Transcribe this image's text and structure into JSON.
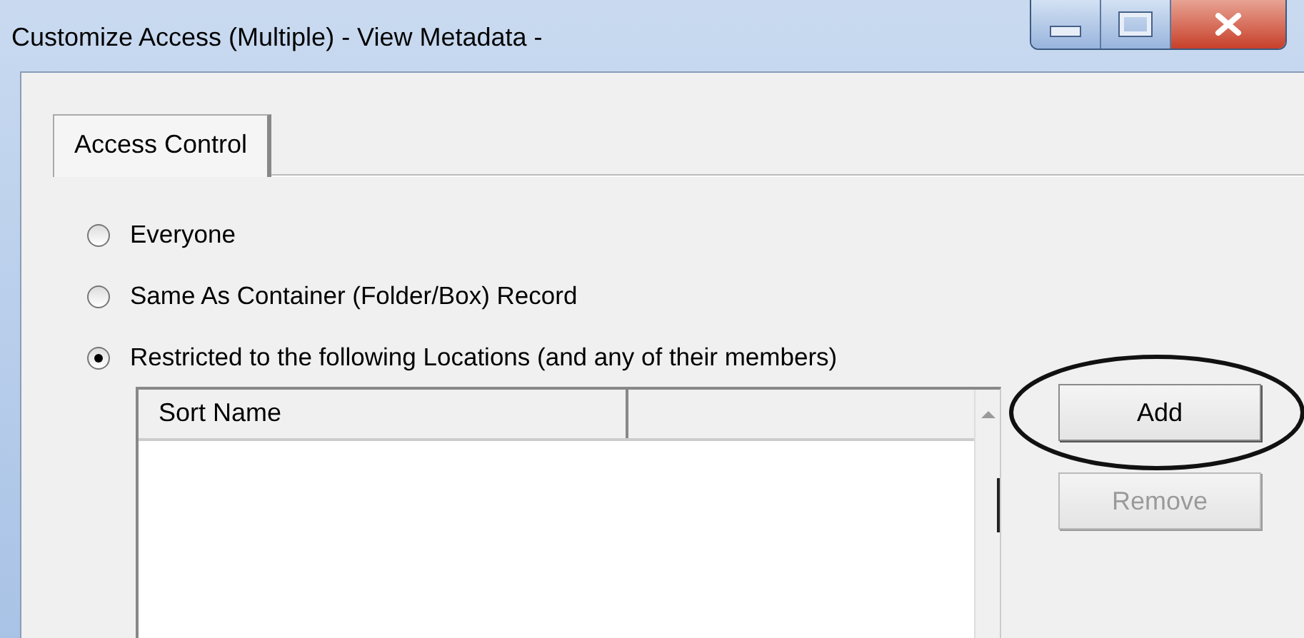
{
  "window": {
    "title": "Customize Access (Multiple) - View Metadata -"
  },
  "tabs": [
    {
      "label": "Access Control",
      "selected": true
    }
  ],
  "access_options": [
    {
      "label": "Everyone",
      "selected": false
    },
    {
      "label": "Same As Container (Folder/Box) Record",
      "selected": false
    },
    {
      "label": "Restricted to the following Locations (and any of their members)",
      "selected": true
    }
  ],
  "locations_list": {
    "columns": [
      {
        "label": "Sort Name"
      }
    ]
  },
  "buttons": [
    {
      "label": "Add",
      "disabled": false,
      "highlighted": true
    },
    {
      "label": "Remove",
      "disabled": true,
      "highlighted": false
    }
  ]
}
